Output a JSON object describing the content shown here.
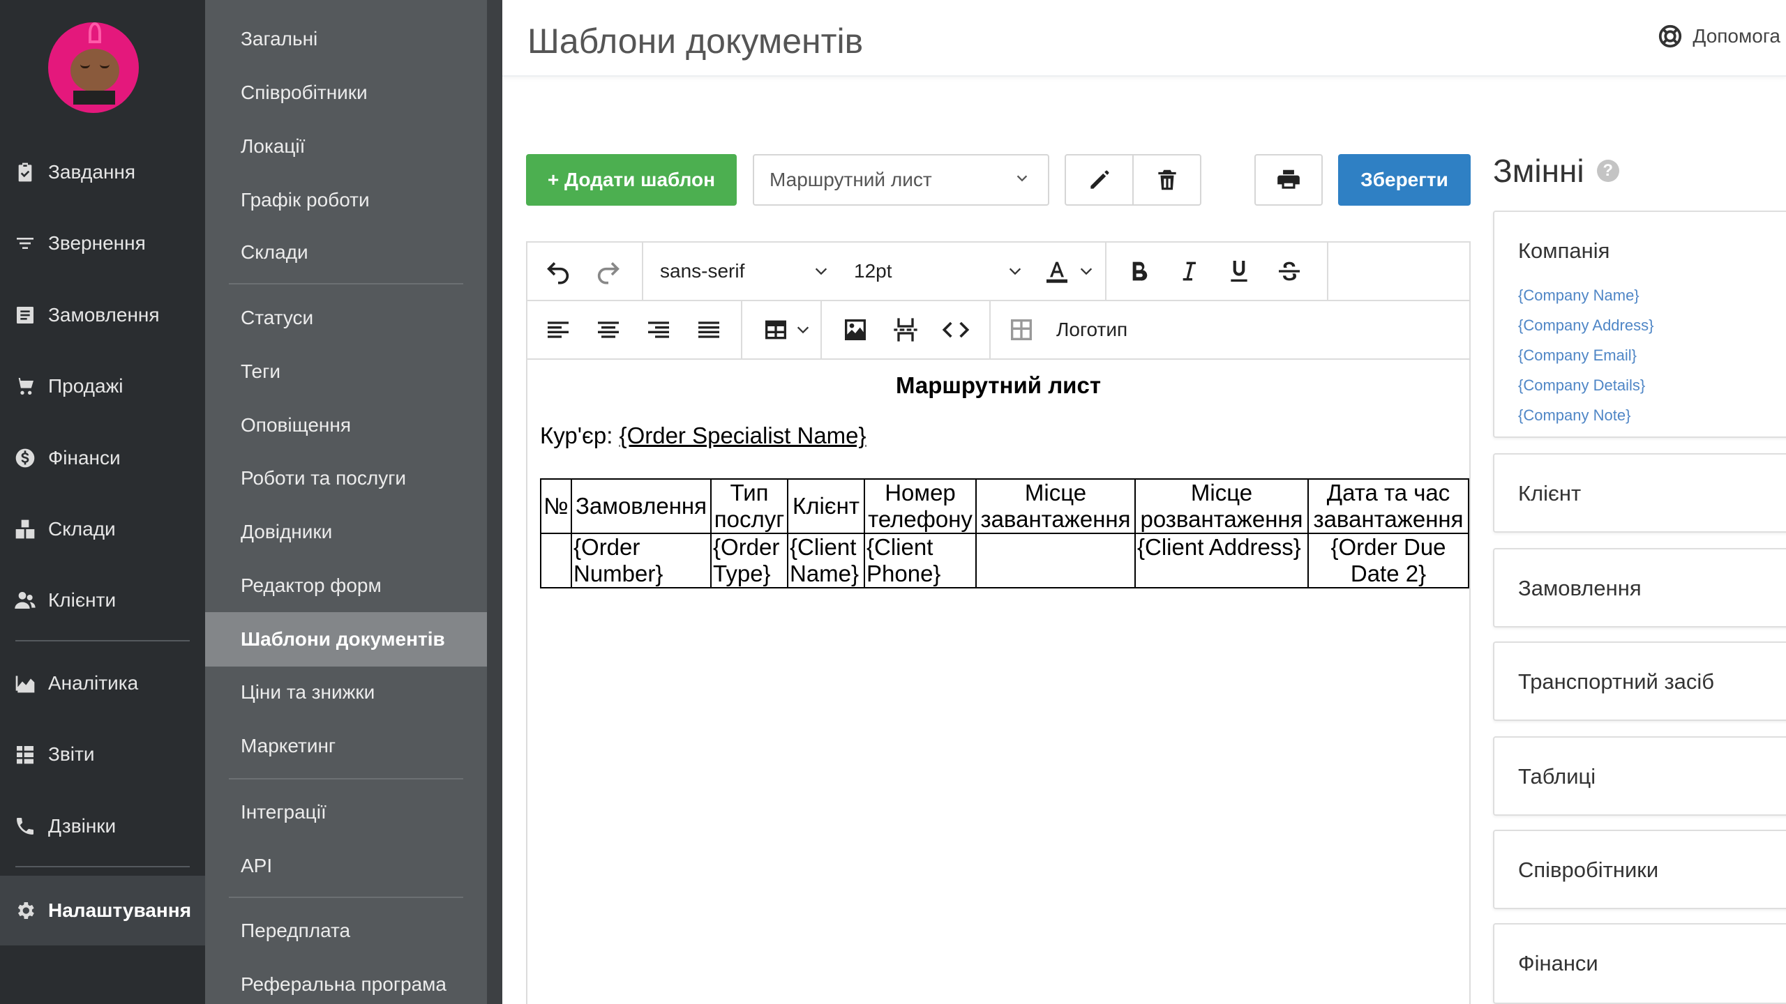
{
  "nav": {
    "items": [
      {
        "label": "Завдання",
        "icon": "clipboard-check-icon"
      },
      {
        "label": "Звернення",
        "icon": "filter-lines-icon"
      },
      {
        "label": "Замовлення",
        "icon": "list-box-icon"
      },
      {
        "label": "Продажі",
        "icon": "shopping-cart-icon"
      },
      {
        "label": "Фінанси",
        "icon": "dollar-circle-icon"
      },
      {
        "label": "Склади",
        "icon": "boxes-icon"
      },
      {
        "label": "Клієнти",
        "icon": "users-icon"
      },
      {
        "label": "Аналітика",
        "icon": "area-chart-icon"
      },
      {
        "label": "Звіти",
        "icon": "table-list-icon"
      },
      {
        "label": "Дзвінки",
        "icon": "phone-icon"
      },
      {
        "label": "Налаштування",
        "icon": "gear-icon"
      }
    ],
    "active": "Налаштування"
  },
  "submenu": {
    "items": [
      "Загальні",
      "Співробітники",
      "Локації",
      "Графік роботи",
      "Склади",
      "Статуси",
      "Теги",
      "Оповіщення",
      "Роботи та послуги",
      "Довідники",
      "Редактор форм",
      "Шаблони документів",
      "Ціни та знижки",
      "Маркетинг",
      "Інтеграції",
      "API",
      "Передплата",
      "Реферальна програма"
    ],
    "active": "Шаблони документів"
  },
  "header": {
    "title": "Шаблони документів",
    "help_label": "Допомога"
  },
  "actions": {
    "add_template_label": "+ Додати шаблон",
    "template_select_value": "Маршрутний лист",
    "save_label": "Зберегти"
  },
  "editor_toolbar": {
    "font_family": "sans-serif",
    "font_size": "12pt",
    "logo_label": "Логотип"
  },
  "document": {
    "title": "Маршрутний лист",
    "courier_label": "Кур'єр: ",
    "courier_placeholder": "{Order Specialist Name}",
    "table": {
      "headers": [
        "№",
        "Замовлення",
        "Тип послуг",
        "Клієнт",
        "Номер телефону",
        "Місце завантаження",
        "Місце розвантаження",
        "Дата та час завантаження"
      ],
      "row": [
        "",
        "{Order Number}",
        "{Order Type}",
        "{Client Name}",
        "{Client Phone}",
        "",
        "{Client Address}",
        "{Order Due Date 2}"
      ]
    }
  },
  "variables": {
    "title": "Змінні",
    "groups": [
      {
        "name": "Компанія",
        "items": [
          "{Company Name}",
          "{Company Address}",
          "{Company Email}",
          "{Company Details}",
          "{Company Note}"
        ]
      },
      {
        "name": "Клієнт",
        "items": []
      },
      {
        "name": "Замовлення",
        "items": []
      },
      {
        "name": "Транспортний засіб",
        "items": []
      },
      {
        "name": "Таблиці",
        "items": []
      },
      {
        "name": "Співробітники",
        "items": []
      },
      {
        "name": "Фінанси",
        "items": []
      }
    ],
    "link_color": "#4f86c6"
  },
  "colors": {
    "nav_bg": "#2a2d30",
    "submenu_bg": "#55595c",
    "submenu_active": "#838689",
    "add_button": "#4caf50",
    "save_button": "#2f80c4"
  }
}
